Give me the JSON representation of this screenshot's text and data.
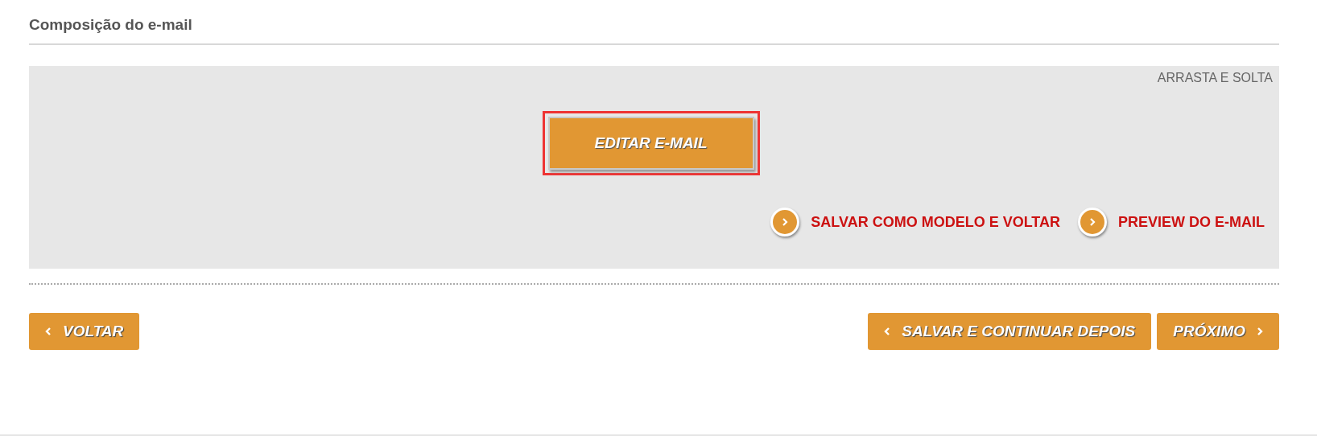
{
  "section": {
    "title": "Composição do e-mail"
  },
  "panel": {
    "mode_label": "ARRASTA E SOLTA",
    "edit_button": {
      "label": "EDITAR E-MAIL",
      "highlighted": true
    },
    "links": [
      {
        "label": "SALVAR COMO MODELO E VOLTAR"
      },
      {
        "label": "PREVIEW DO E-MAIL"
      }
    ]
  },
  "footer_buttons": [
    {
      "label": "VOLTAR",
      "kind": "back"
    },
    {
      "label": "SALVAR E CONTINUAR DEPOIS",
      "kind": "back"
    },
    {
      "label": "PRÓXIMO",
      "kind": "next"
    }
  ]
}
